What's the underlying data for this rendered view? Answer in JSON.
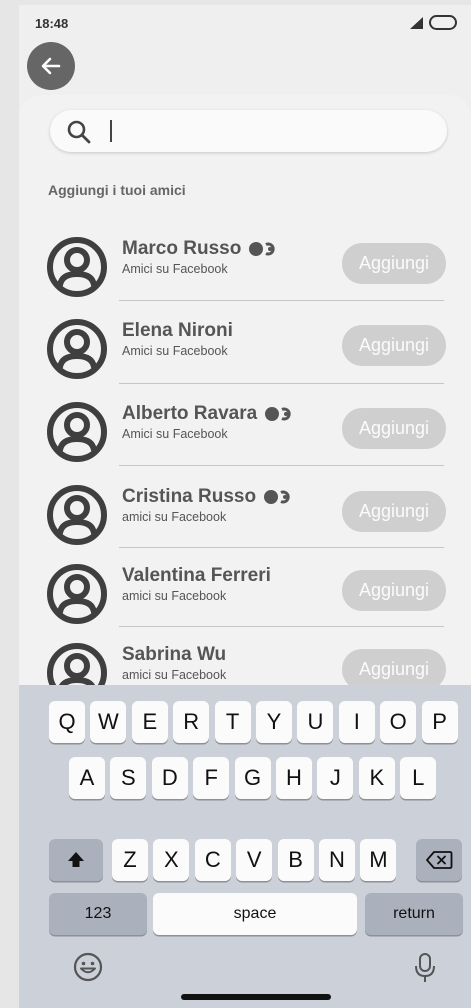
{
  "status": {
    "time": "18:48"
  },
  "search": {
    "placeholder": ""
  },
  "section_label": "Aggiungi i tuoi amici",
  "contacts": [
    {
      "name": "Marco Russo",
      "subtitle": "Amici su Facebook",
      "has_toggle": true,
      "button": "Aggiungi"
    },
    {
      "name": "Elena Nironi",
      "subtitle": "Amici su Facebook",
      "has_toggle": false,
      "button": "Aggiungi"
    },
    {
      "name": "Alberto Ravara",
      "subtitle": "Amici su Facebook",
      "has_toggle": true,
      "button": "Aggiungi"
    },
    {
      "name": "Cristina Russo",
      "subtitle": "amici su Facebook",
      "has_toggle": true,
      "button": "Aggiungi"
    },
    {
      "name": "Valentina Ferreri",
      "subtitle": "amici su Facebook",
      "has_toggle": false,
      "button": "Aggiungi"
    },
    {
      "name": "Sabrina Wu",
      "subtitle": "amici su Facebook",
      "has_toggle": false,
      "button": "Aggiungi"
    }
  ],
  "keyboard": {
    "row1": [
      "Q",
      "W",
      "E",
      "R",
      "T",
      "Y",
      "U",
      "I",
      "O",
      "P"
    ],
    "row2": [
      "A",
      "S",
      "D",
      "F",
      "G",
      "H",
      "J",
      "K",
      "L"
    ],
    "row3": [
      "Z",
      "X",
      "C",
      "V",
      "B",
      "N",
      "M"
    ],
    "numbers_label": "123",
    "space_label": "space",
    "return_label": "return"
  },
  "icons": {
    "back": "arrow-left-icon",
    "search": "search-icon",
    "avatar": "user-avatar-icon",
    "shift": "shift-icon",
    "backspace": "backspace-icon",
    "emoji": "emoji-icon",
    "mic": "microphone-icon"
  },
  "colors": {
    "back_button": "#666666",
    "add_button": "#cfcfcf",
    "keyboard_bg": "#ccd0d8"
  }
}
